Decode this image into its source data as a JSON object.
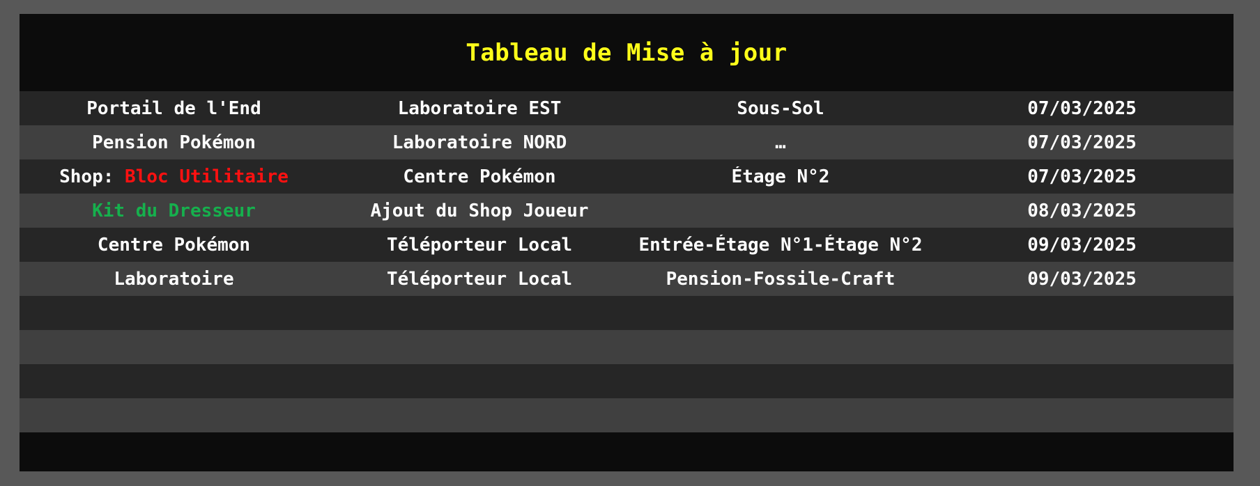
{
  "title": "Tableau de Mise à jour",
  "colors": {
    "outer_frame": "#585858",
    "panel_background": "#0c0c0c",
    "title_text": "#ffff1a",
    "row_dark": "#262626",
    "row_light": "#404040",
    "text_default": "#ffffff",
    "text_red": "#ff1111",
    "text_green": "#16b04d"
  },
  "rows": [
    {
      "c1": "Portail de l'End",
      "c2": "Laboratoire EST",
      "c3": "Sous-Sol",
      "c4": "07/03/2025"
    },
    {
      "c1": "Pension Pokémon",
      "c2": "Laboratoire NORD",
      "c3": "…",
      "c4": "07/03/2025"
    },
    {
      "c1_prefix": "Shop: ",
      "c1_item": "Bloc Utilitaire",
      "c2": "Centre Pokémon",
      "c3": "Étage N°2",
      "c4": "07/03/2025"
    },
    {
      "c1": "Kit du Dresseur",
      "c2": "Ajout du Shop Joueur",
      "c3": "",
      "c4": "08/03/2025"
    },
    {
      "c1": "Centre Pokémon",
      "c2": "Téléporteur Local",
      "c3": "Entrée-Étage N°1-Étage N°2",
      "c4": "09/03/2025"
    },
    {
      "c1": "Laboratoire",
      "c2": "Téléporteur Local",
      "c3": "Pension-Fossile-Craft",
      "c4": "09/03/2025"
    },
    {
      "c1": "",
      "c2": "",
      "c3": "",
      "c4": ""
    },
    {
      "c1": "",
      "c2": "",
      "c3": "",
      "c4": ""
    },
    {
      "c1": "",
      "c2": "",
      "c3": "",
      "c4": ""
    },
    {
      "c1": "",
      "c2": "",
      "c3": "",
      "c4": ""
    }
  ]
}
